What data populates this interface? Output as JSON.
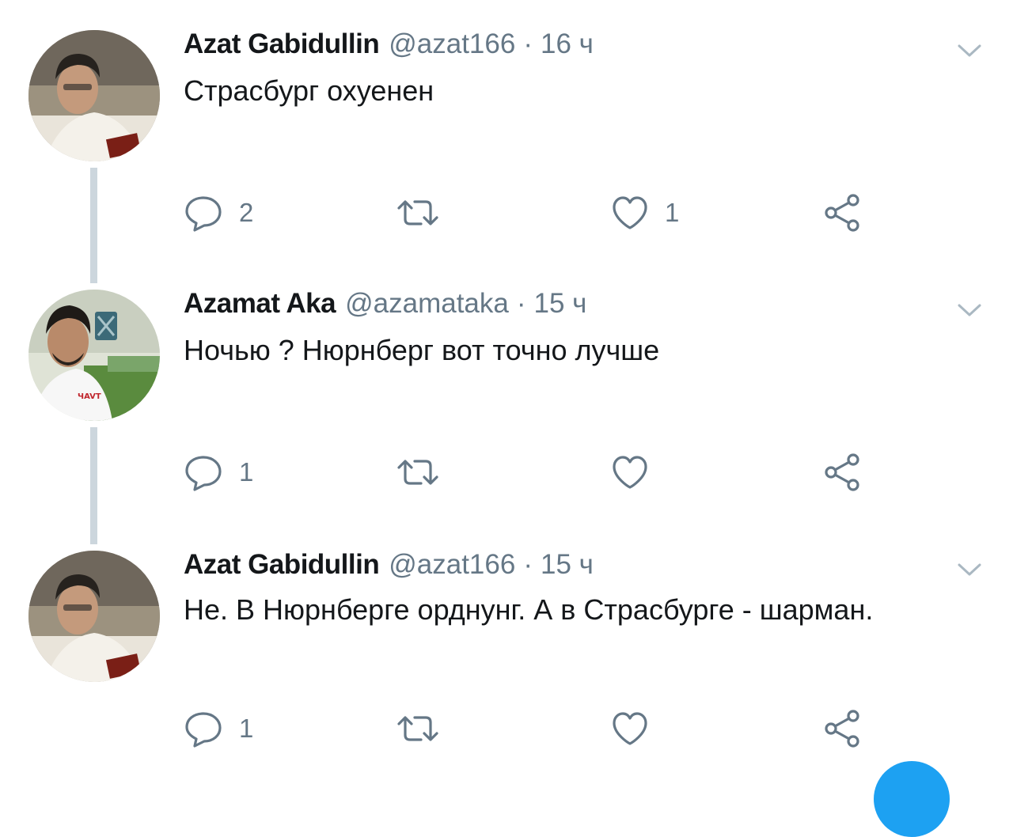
{
  "tweets": [
    {
      "name": "Azat Gabidullin",
      "handle": "@azat166",
      "separator": "·",
      "time": "16 ч",
      "text": "Страсбург охуенен",
      "reply_count": "2",
      "retweet_count": "",
      "like_count": "1"
    },
    {
      "name": "Azamat Aka",
      "handle": "@azamataka",
      "separator": "·",
      "time": "15 ч",
      "text": "Ночью ? Нюрнберг вот точно лучше",
      "reply_count": "1",
      "retweet_count": "",
      "like_count": ""
    },
    {
      "name": "Azat Gabidullin",
      "handle": "@azat166",
      "separator": "·",
      "time": "15 ч",
      "text": "Не. В Нюрнберге орднунг. А в Страсбурге  - шарман.",
      "reply_count": "1",
      "retweet_count": "",
      "like_count": ""
    }
  ],
  "icons": {
    "reply": "reply-icon",
    "retweet": "retweet-icon",
    "like": "heart-icon",
    "share": "share-icon",
    "more": "chevron-down-icon"
  },
  "colors": {
    "text": "#14171a",
    "secondary": "#657786",
    "thread_line": "#ccd6dd",
    "accent": "#1da1f2"
  }
}
